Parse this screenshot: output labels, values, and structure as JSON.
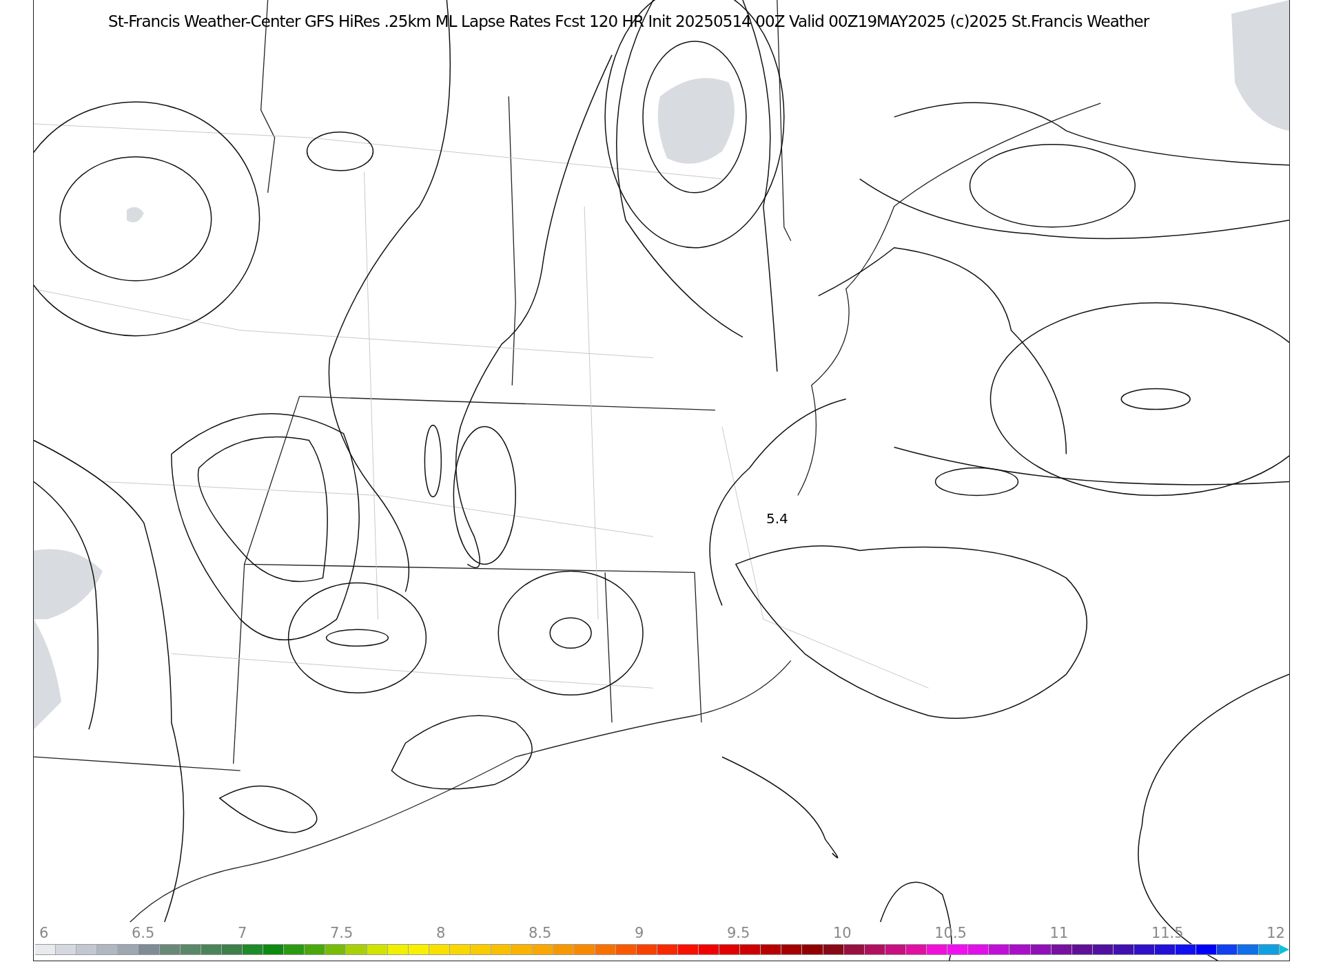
{
  "title": "St-Francis Weather-Center GFS HiRes .25km ML Lapse Rates  Fcst 120 HR Init 20250514 00Z  Valid 00Z19MAY2025    (c)2025 St.Francis Weather",
  "contour_label": "5.4",
  "colorbar": {
    "ticks": [
      "6",
      "6.5",
      "7",
      "7.5",
      "8",
      "8.5",
      "9",
      "9.5",
      "10",
      "10.5",
      "11",
      "11.5",
      "12"
    ],
    "cells": [
      {
        "color": "#e8eaee"
      },
      {
        "color": "#d5d9df"
      },
      {
        "color": "#c3c8d0"
      },
      {
        "color": "#b0b7c1"
      },
      {
        "color": "#9ea6b2"
      },
      {
        "color": "#7f8c96"
      },
      {
        "color": "#6a8878"
      },
      {
        "color": "#5a8868"
      },
      {
        "color": "#4a8458"
      },
      {
        "color": "#3e7f4a"
      },
      {
        "color": "#1f8a2a"
      },
      {
        "color": "#0e8a10"
      },
      {
        "color": "#2a9a10"
      },
      {
        "color": "#4aa80a"
      },
      {
        "color": "#78bb08"
      },
      {
        "color": "#a8d008"
      },
      {
        "color": "#d0e400"
      },
      {
        "color": "#f0f000"
      },
      {
        "color": "#f8f000"
      },
      {
        "color": "#f8e000"
      },
      {
        "color": "#f8d800"
      },
      {
        "color": "#f8cc00"
      },
      {
        "color": "#f8c000"
      },
      {
        "color": "#f8b400"
      },
      {
        "color": "#f8a800"
      },
      {
        "color": "#f89800"
      },
      {
        "color": "#f88800"
      },
      {
        "color": "#f87000"
      },
      {
        "color": "#f85800"
      },
      {
        "color": "#f84000"
      },
      {
        "color": "#f82800"
      },
      {
        "color": "#f81000"
      },
      {
        "color": "#f00000"
      },
      {
        "color": "#e00000"
      },
      {
        "color": "#cc0000"
      },
      {
        "color": "#b80000"
      },
      {
        "color": "#a40000"
      },
      {
        "color": "#900000"
      },
      {
        "color": "#880818"
      },
      {
        "color": "#981040"
      },
      {
        "color": "#b01060"
      },
      {
        "color": "#c81080"
      },
      {
        "color": "#e010a0"
      },
      {
        "color": "#f010d8"
      },
      {
        "color": "#f010f0"
      },
      {
        "color": "#e010e8"
      },
      {
        "color": "#c010d8"
      },
      {
        "color": "#a810c8"
      },
      {
        "color": "#9010b8"
      },
      {
        "color": "#7810a0"
      },
      {
        "color": "#601098"
      },
      {
        "color": "#5010a0"
      },
      {
        "color": "#4010b0"
      },
      {
        "color": "#3010c8"
      },
      {
        "color": "#2010d8"
      },
      {
        "color": "#1010f0"
      },
      {
        "color": "#0000f8"
      },
      {
        "color": "#1040f0"
      },
      {
        "color": "#1070e8"
      },
      {
        "color": "#10a0e0"
      }
    ],
    "over_arrow": {
      "color": "#10c0d8"
    }
  }
}
